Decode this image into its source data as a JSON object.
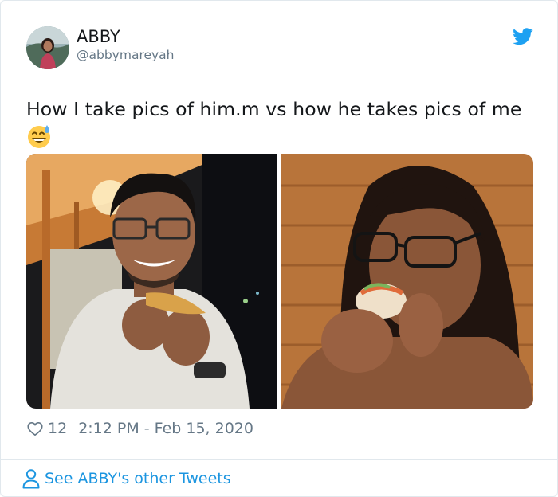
{
  "user": {
    "display_name": "ABBY",
    "handle": "@abbymareyah"
  },
  "tweet": {
    "text": "How I take pics of him.m vs how he takes pics of me",
    "emoji": "grinning-face-with-sweat"
  },
  "media": {
    "left_photo": "man-eating-taco-photo",
    "right_photo": "woman-eating-sandwich-photo"
  },
  "meta": {
    "likes": "12",
    "timestamp": "2:12 PM - Feb 15, 2020"
  },
  "footer": {
    "see_more_label": "See ABBY's other Tweets"
  },
  "colors": {
    "brand_blue": "#1da1f2",
    "link_blue": "#1b95e0",
    "secondary_text": "#657786",
    "border": "#e1e8ed"
  }
}
